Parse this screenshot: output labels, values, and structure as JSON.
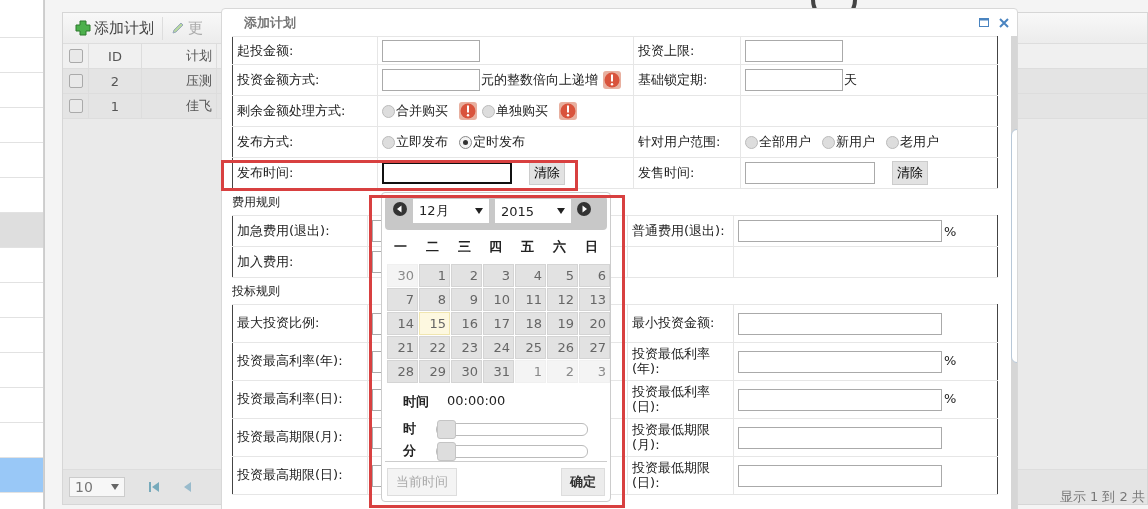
{
  "sidebar": {
    "items": [
      {
        "selected": false,
        "hovered": false
      },
      {
        "selected": false,
        "hovered": false
      },
      {
        "selected": false,
        "hovered": false
      },
      {
        "selected": false,
        "hovered": false
      },
      {
        "selected": false,
        "hovered": false
      },
      {
        "selected": false,
        "hovered": false
      },
      {
        "selected": false,
        "hovered": true
      },
      {
        "selected": false,
        "hovered": false
      },
      {
        "selected": false,
        "hovered": false
      },
      {
        "selected": false,
        "hovered": false
      },
      {
        "selected": false,
        "hovered": false
      },
      {
        "selected": false,
        "hovered": false
      },
      {
        "selected": false,
        "hovered": false
      },
      {
        "selected": true,
        "hovered": false
      },
      {
        "selected": false,
        "hovered": false
      }
    ]
  },
  "toolbar": {
    "buttons": [
      {
        "kind": "add",
        "label": "添加计划",
        "disabled": false
      },
      {
        "kind": "edit",
        "label": "更",
        "disabled": true
      }
    ]
  },
  "grid": {
    "all_checked": false,
    "columns": [
      "ID",
      "计划"
    ],
    "rows": [
      {
        "id": "2",
        "name": "压测",
        "checked": false
      },
      {
        "id": "1",
        "name": "佳飞",
        "checked": false
      }
    ]
  },
  "pager": {
    "page_size": "10",
    "summary": "显示 1 到 2 共"
  },
  "dialog": {
    "title": "添加计划",
    "form": {
      "rows": [
        {
          "cells": [
            {
              "label": "起投金额:",
              "controls": [
                {
                  "kind": "input"
                }
              ]
            },
            {
              "label": "投资上限:",
              "controls": [
                {
                  "kind": "input"
                }
              ]
            }
          ]
        },
        {
          "cells": [
            {
              "label": "投资金额方式:",
              "controls": [
                {
                  "kind": "input"
                },
                {
                  "kind": "text",
                  "label": "元的整数倍向上递增"
                },
                {
                  "kind": "warning"
                }
              ]
            },
            {
              "label": "基础锁定期:",
              "controls": [
                {
                  "kind": "input"
                },
                {
                  "kind": "text",
                  "label": "天"
                }
              ]
            }
          ]
        },
        {
          "cells": [
            {
              "label": "剩余金额处理方式:",
              "controls": [
                {
                  "kind": "radio",
                  "label": "合并购买",
                  "selected": false
                },
                {
                  "kind": "warning"
                },
                {
                  "kind": "radio",
                  "label": "单独购买",
                  "selected": false
                },
                {
                  "kind": "warning"
                }
              ]
            }
          ]
        },
        {
          "cells": [
            {
              "label": "发布方式:",
              "controls": [
                {
                  "kind": "radio",
                  "label": "立即发布",
                  "selected": false
                },
                {
                  "kind": "radio",
                  "label": "定时发布",
                  "selected": true
                }
              ]
            },
            {
              "label": "针对用户范围:",
              "controls": [
                {
                  "kind": "radio",
                  "label": "全部用户",
                  "selected": false
                },
                {
                  "kind": "radio",
                  "label": "新用户",
                  "selected": false
                },
                {
                  "kind": "radio",
                  "label": "老用户",
                  "selected": false
                }
              ]
            }
          ]
        },
        {
          "cells": [
            {
              "label": "发布时间:",
              "controls": [
                {
                  "kind": "date",
                  "focused": true
                },
                {
                  "kind": "button",
                  "label": "清除"
                }
              ]
            },
            {
              "label": "发售时间:",
              "controls": [
                {
                  "kind": "date",
                  "focused": false
                },
                {
                  "kind": "button",
                  "label": "清除"
                }
              ]
            }
          ]
        }
      ]
    },
    "fee_rules": {
      "title": "费用规则",
      "rows": [
        {
          "cells": [
            {
              "label": "加急费用(退出):",
              "controls": [
                {
                  "kind": "input"
                }
              ]
            },
            {
              "label": "普通费用(退出):",
              "controls": [
                {
                  "kind": "input"
                },
                {
                  "kind": "text",
                  "label": "%"
                }
              ]
            }
          ]
        },
        {
          "cells": [
            {
              "label": "加入费用:",
              "controls": [
                {
                  "kind": "input"
                }
              ]
            }
          ]
        }
      ]
    },
    "bid_rules": {
      "title": "投标规则",
      "rows": [
        {
          "cells": [
            {
              "label": "最大投资比例:",
              "controls": [
                {
                  "kind": "input"
                }
              ]
            },
            {
              "label": "最小投资金额:",
              "controls": [
                {
                  "kind": "input"
                }
              ]
            }
          ]
        },
        {
          "cells": [
            {
              "label": "投资最高利率(年):",
              "controls": [
                {
                  "kind": "input"
                }
              ]
            },
            {
              "label": "投资最低利率(年):",
              "controls": [
                {
                  "kind": "input"
                },
                {
                  "kind": "text",
                  "label": "%"
                }
              ]
            }
          ]
        },
        {
          "cells": [
            {
              "label": "投资最高利率(日):",
              "controls": [
                {
                  "kind": "input"
                }
              ]
            },
            {
              "label": "投资最低利率(日):",
              "controls": [
                {
                  "kind": "input"
                },
                {
                  "kind": "text",
                  "label": "%"
                }
              ]
            }
          ]
        },
        {
          "cells": [
            {
              "label": "投资最高期限(月):",
              "controls": [
                {
                  "kind": "input"
                }
              ]
            },
            {
              "label": "投资最低期限(月):",
              "controls": [
                {
                  "kind": "input"
                }
              ]
            }
          ]
        },
        {
          "cells": [
            {
              "label": "投资最高期限(日):",
              "controls": [
                {
                  "kind": "input"
                }
              ]
            },
            {
              "label": "投资最低期限(日):",
              "controls": [
                {
                  "kind": "input"
                }
              ]
            }
          ]
        }
      ]
    }
  },
  "calendar": {
    "month": "12月",
    "year": "2015",
    "weekdays": [
      "一",
      "二",
      "三",
      "四",
      "五",
      "六",
      "日"
    ],
    "days": [
      {
        "label": "30",
        "other_month": true,
        "today": false
      },
      {
        "label": "1",
        "other_month": false,
        "today": false
      },
      {
        "label": "2",
        "other_month": false,
        "today": false
      },
      {
        "label": "3",
        "other_month": false,
        "today": false
      },
      {
        "label": "4",
        "other_month": false,
        "today": false
      },
      {
        "label": "5",
        "other_month": false,
        "today": false
      },
      {
        "label": "6",
        "other_month": false,
        "today": false
      },
      {
        "label": "7",
        "other_month": false,
        "today": false
      },
      {
        "label": "8",
        "other_month": false,
        "today": false
      },
      {
        "label": "9",
        "other_month": false,
        "today": false
      },
      {
        "label": "10",
        "other_month": false,
        "today": false
      },
      {
        "label": "11",
        "other_month": false,
        "today": false
      },
      {
        "label": "12",
        "other_month": false,
        "today": false
      },
      {
        "label": "13",
        "other_month": false,
        "today": false
      },
      {
        "label": "14",
        "other_month": false,
        "today": false
      },
      {
        "label": "15",
        "other_month": false,
        "today": true
      },
      {
        "label": "16",
        "other_month": false,
        "today": false
      },
      {
        "label": "17",
        "other_month": false,
        "today": false
      },
      {
        "label": "18",
        "other_month": false,
        "today": false
      },
      {
        "label": "19",
        "other_month": false,
        "today": false
      },
      {
        "label": "20",
        "other_month": false,
        "today": false
      },
      {
        "label": "21",
        "other_month": false,
        "today": false
      },
      {
        "label": "22",
        "other_month": false,
        "today": false
      },
      {
        "label": "23",
        "other_month": false,
        "today": false
      },
      {
        "label": "24",
        "other_month": false,
        "today": false
      },
      {
        "label": "25",
        "other_month": false,
        "today": false
      },
      {
        "label": "26",
        "other_month": false,
        "today": false
      },
      {
        "label": "27",
        "other_month": false,
        "today": false
      },
      {
        "label": "28",
        "other_month": false,
        "today": false
      },
      {
        "label": "29",
        "other_month": false,
        "today": false
      },
      {
        "label": "30",
        "other_month": false,
        "today": false
      },
      {
        "label": "31",
        "other_month": false,
        "today": false
      },
      {
        "label": "1",
        "other_month": true,
        "today": false
      },
      {
        "label": "2",
        "other_month": true,
        "today": false
      },
      {
        "label": "3",
        "other_month": true,
        "today": false
      }
    ],
    "time_label": "时间",
    "time_value": "00:00:00",
    "sliders": [
      {
        "label": "时",
        "level": 0
      },
      {
        "label": "分",
        "level": 0
      }
    ],
    "buttons": [
      {
        "label": "当前时间",
        "disabled": true
      },
      {
        "label": "确定",
        "disabled": false
      }
    ]
  }
}
